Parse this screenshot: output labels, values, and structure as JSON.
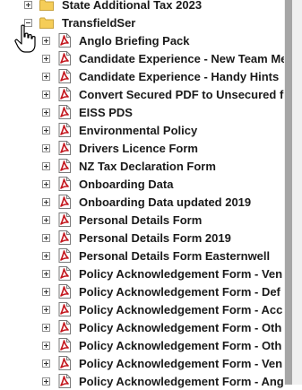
{
  "tree": {
    "nodes": [
      {
        "label": "State Additional Tax 2023",
        "type": "folder",
        "expanded": false,
        "level": 0
      },
      {
        "label": "TransfieldSer",
        "type": "folder",
        "expanded": true,
        "level": 0
      },
      {
        "label": "Anglo Briefing Pack",
        "type": "pdf",
        "expanded": false,
        "level": 1
      },
      {
        "label": "Candidate Experience - New Team Me",
        "type": "pdf",
        "expanded": false,
        "level": 1
      },
      {
        "label": "Candidate Experience - Handy Hints",
        "type": "pdf",
        "expanded": false,
        "level": 1
      },
      {
        "label": "Convert Secured PDF to Unsecured f",
        "type": "pdf",
        "expanded": false,
        "level": 1
      },
      {
        "label": "EISS PDS",
        "type": "pdf",
        "expanded": false,
        "level": 1
      },
      {
        "label": "Environmental Policy",
        "type": "pdf",
        "expanded": false,
        "level": 1
      },
      {
        "label": "Drivers Licence Form",
        "type": "pdf",
        "expanded": false,
        "level": 1
      },
      {
        "label": "NZ Tax Declaration Form",
        "type": "pdf",
        "expanded": false,
        "level": 1
      },
      {
        "label": "Onboarding Data",
        "type": "pdf",
        "expanded": false,
        "level": 1
      },
      {
        "label": "Onboarding Data updated 2019",
        "type": "pdf",
        "expanded": false,
        "level": 1
      },
      {
        "label": "Personal Details Form",
        "type": "pdf",
        "expanded": false,
        "level": 1
      },
      {
        "label": "Personal Details Form 2019",
        "type": "pdf",
        "expanded": false,
        "level": 1
      },
      {
        "label": "Personal Details Form Easternwell",
        "type": "pdf",
        "expanded": false,
        "level": 1
      },
      {
        "label": "Policy Acknowledgement Form - Ven",
        "type": "pdf",
        "expanded": false,
        "level": 1
      },
      {
        "label": "Policy Acknowledgement Form - Def",
        "type": "pdf",
        "expanded": false,
        "level": 1
      },
      {
        "label": "Policy Acknowledgement Form - Acc",
        "type": "pdf",
        "expanded": false,
        "level": 1
      },
      {
        "label": "Policy Acknowledgement Form - Oth",
        "type": "pdf",
        "expanded": false,
        "level": 1
      },
      {
        "label": "Policy Acknowledgement Form - Oth",
        "type": "pdf",
        "expanded": false,
        "level": 1
      },
      {
        "label": "Policy Acknowledgement Form - Ven",
        "type": "pdf",
        "expanded": false,
        "level": 1
      },
      {
        "label": "Policy Acknowledgement Form - Ang",
        "type": "pdf",
        "expanded": false,
        "level": 1
      }
    ]
  },
  "colors": {
    "folder": "#f5cd58",
    "folder_edge": "#c8a23c",
    "pdf_red": "#c4181f",
    "text": "#1a1a1a",
    "scrollbar_track": "#f0f0f0",
    "scrollbar_thumb": "#a6a6a6"
  },
  "icons": {
    "folder": "folder-icon",
    "pdf": "pdf-file-icon",
    "expand": "expand-plus-icon",
    "collapse": "collapse-minus-icon",
    "cursor": "hand-pointer-cursor"
  }
}
